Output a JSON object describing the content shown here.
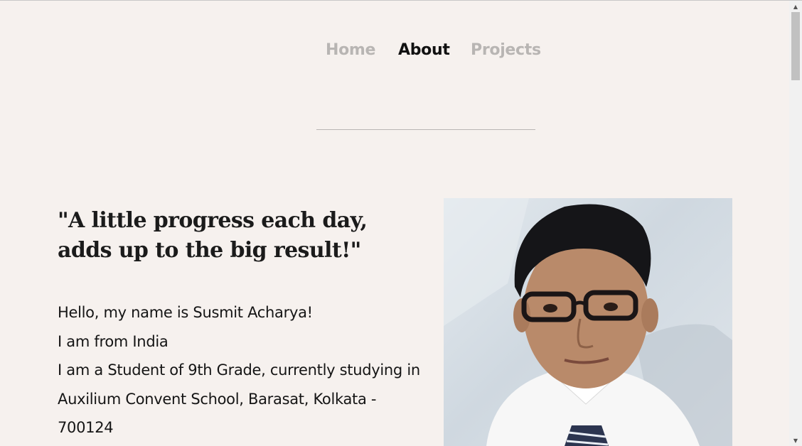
{
  "nav": {
    "home": "Home",
    "about": "About",
    "projects": "Projects",
    "active": "About"
  },
  "quote": {
    "line1": "\"A little progress each day,",
    "line2": "adds up to the big result!\""
  },
  "bio": {
    "line1": "Hello, my name is Susmit Acharya!",
    "line2": "I am from India",
    "line3": "I am a Student of 9th Grade, currently studying in",
    "line4": "Auxilium Convent School, Barasat, Kolkata -",
    "line5": "700124"
  },
  "photo": {
    "icon": "portrait-photo"
  },
  "colors": {
    "background": "#f6f1ee",
    "nav_inactive": "#b8b5b3",
    "nav_active": "#111111",
    "text": "#151515"
  }
}
